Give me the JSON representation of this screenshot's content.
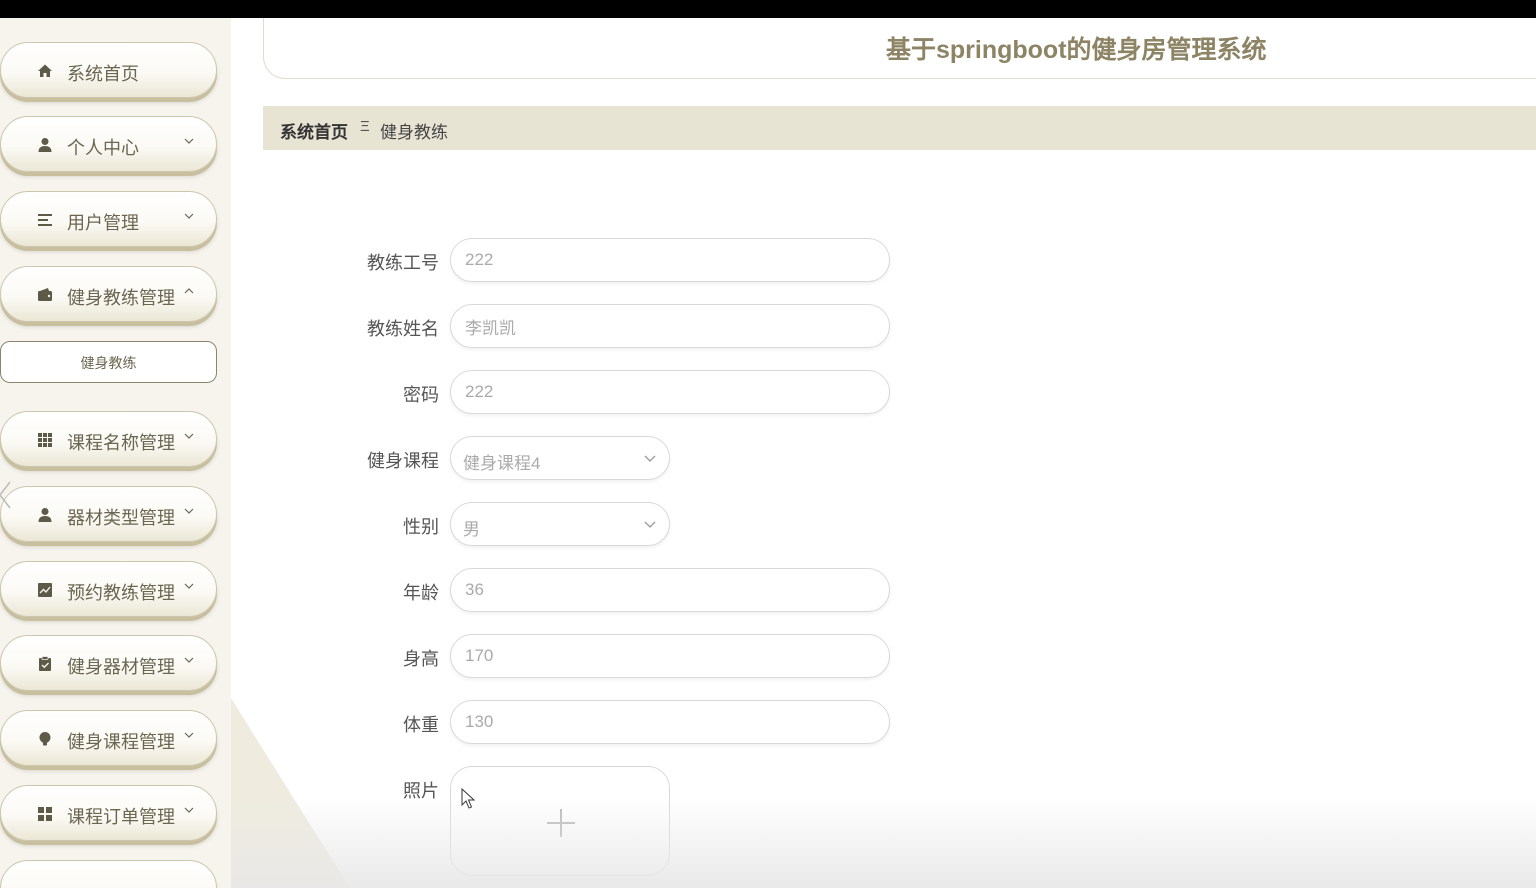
{
  "app": {
    "title": "基于springboot的健身房管理系统"
  },
  "sidebar": {
    "items": [
      {
        "label": "系统首页",
        "icon": "home-icon",
        "has_arrow": false
      },
      {
        "label": "个人中心",
        "icon": "user-icon",
        "has_arrow": true
      },
      {
        "label": "用户管理",
        "icon": "list-icon",
        "has_arrow": true
      },
      {
        "label": "健身教练管理",
        "icon": "wallet-icon",
        "has_arrow": true,
        "expanded": true
      },
      {
        "label": "课程名称管理",
        "icon": "grid-icon",
        "has_arrow": true
      },
      {
        "label": "器材类型管理",
        "icon": "user-icon",
        "has_arrow": true
      },
      {
        "label": "预约教练管理",
        "icon": "chart-icon",
        "has_arrow": true
      },
      {
        "label": "健身器材管理",
        "icon": "clipboard-icon",
        "has_arrow": true
      },
      {
        "label": "健身课程管理",
        "icon": "bulb-icon",
        "has_arrow": true
      },
      {
        "label": "课程订单管理",
        "icon": "apps-icon",
        "has_arrow": true
      }
    ],
    "sub_item": {
      "label": "健身教练"
    }
  },
  "breadcrumb": {
    "home": "系统首页",
    "separator": "Ξ",
    "current": "健身教练"
  },
  "form": {
    "coach_id": {
      "label": "教练工号",
      "value": "222"
    },
    "coach_name": {
      "label": "教练姓名",
      "value": "李凯凯"
    },
    "password": {
      "label": "密码",
      "value": "222"
    },
    "course": {
      "label": "健身课程",
      "value": "健身课程4"
    },
    "gender": {
      "label": "性别",
      "value": "男"
    },
    "age": {
      "label": "年龄",
      "value": "36"
    },
    "height": {
      "label": "身高",
      "value": "170"
    },
    "weight": {
      "label": "体重",
      "value": "130"
    },
    "photo": {
      "label": "照片"
    }
  },
  "colors": {
    "accent": "#8d8465",
    "sidebar_bg": "#f6f4ec",
    "breadcrumb_bg": "#e8e4d3",
    "menu_text": "#6b6650"
  }
}
